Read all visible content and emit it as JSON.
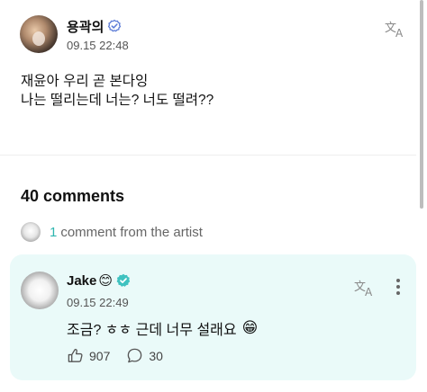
{
  "post": {
    "author": "용곽의",
    "timestamp": "09.15 22:48",
    "body_line1": "재윤아 우리 곧 본다잉",
    "body_line2": "나는 떨리는데 너는? 너도 떨려??"
  },
  "comments": {
    "count_label": "40 comments",
    "artist_count": "1",
    "artist_label": "comment from the artist"
  },
  "artist_comment": {
    "author": "Jake",
    "author_emoji": "😊",
    "timestamp": "09.15 22:49",
    "text": "조금? ㅎㅎ 근데 너무 설래요",
    "text_emoji": "😁",
    "likes": "907",
    "replies": "30"
  },
  "colors": {
    "accent": "#2fb6b0",
    "card_bg": "#eafaf9",
    "verified": "#3fc2c0"
  },
  "icons": [
    "verified-outline-icon",
    "translate-icon",
    "verified-badge-icon",
    "more-vertical-icon",
    "like-icon",
    "reply-icon"
  ]
}
